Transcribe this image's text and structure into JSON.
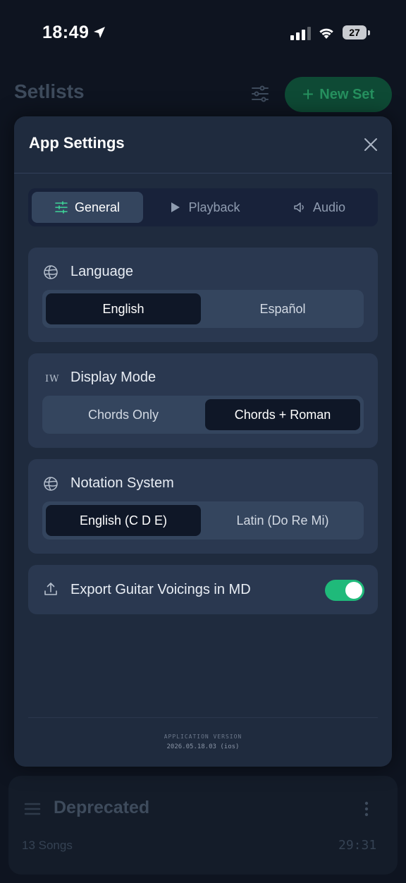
{
  "status_bar": {
    "time": "18:49",
    "battery": "27"
  },
  "background": {
    "title": "Setlists",
    "new_set_label": "New Set",
    "card": {
      "title": "Deprecated",
      "songs": "13 Songs",
      "duration": "29:31"
    }
  },
  "modal": {
    "title": "App Settings",
    "tabs": [
      {
        "label": "General",
        "icon": "sliders-icon",
        "active": true
      },
      {
        "label": "Playback",
        "icon": "play-icon",
        "active": false
      },
      {
        "label": "Audio",
        "icon": "speaker-icon",
        "active": false
      }
    ],
    "language": {
      "label": "Language",
      "options": [
        "English",
        "Español"
      ],
      "selected": "English"
    },
    "display_mode": {
      "label": "Display Mode",
      "icon_text": "IW",
      "options": [
        "Chords Only",
        "Chords + Roman"
      ],
      "selected": "Chords + Roman"
    },
    "notation": {
      "label": "Notation System",
      "options": [
        "English (C D E)",
        "Latin (Do Re Mi)"
      ],
      "selected": "English (C D E)"
    },
    "export": {
      "label": "Export Guitar Voicings in MD",
      "enabled": true
    },
    "footer": {
      "version_label": "APPLICATION VERSION",
      "version": "2026.05.18.03 (ios)"
    }
  },
  "colors": {
    "accent_green": "#1fba7a",
    "modal_bg": "#1f2b3e",
    "page_bg": "#0e1420"
  }
}
